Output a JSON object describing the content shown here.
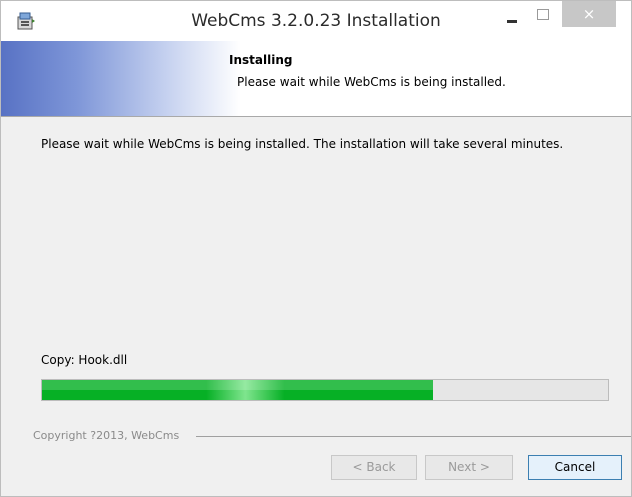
{
  "window": {
    "title": "WebCms 3.2.0.23 Installation",
    "close_glyph": "×"
  },
  "banner": {
    "title": "Installing",
    "subtitle": "Please wait while WebCms is being installed."
  },
  "main": {
    "description": "Please wait while WebCms is being installed. The installation will take several minutes.",
    "current_action": "Copy: Hook.dll",
    "progress_fraction": 0.69
  },
  "footer": {
    "copyright": "Copyright ?2013, WebCms",
    "back_label": "< Back",
    "next_label": "Next >",
    "cancel_label": "Cancel"
  },
  "colors": {
    "progress_green": "#06b025",
    "banner_blue": "#5872c4"
  },
  "icons": {
    "app": "installer-icon",
    "minimize": "minimize-icon",
    "maximize": "maximize-icon",
    "close": "close-icon"
  }
}
